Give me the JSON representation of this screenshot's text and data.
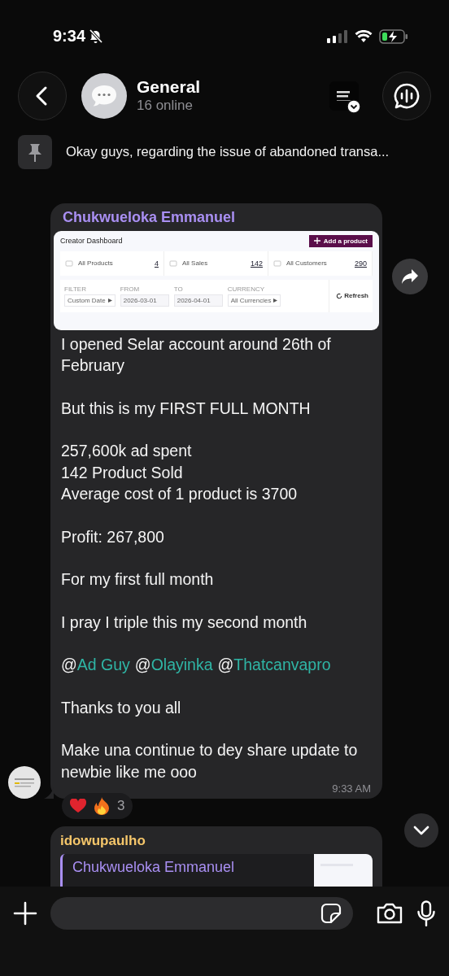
{
  "status_bar": {
    "time": "9:34",
    "silent": true
  },
  "header": {
    "title": "General",
    "subtitle": "16 online"
  },
  "pinned": {
    "text": "Okay guys, regarding the issue of abandoned transa..."
  },
  "message": {
    "sender": "Chukwueloka Emmanuel",
    "time": "9:33 AM",
    "dashboard": {
      "title": "Creator Dashboard",
      "add_button": "Add a product",
      "stats": [
        {
          "label": "All Products",
          "value": "4"
        },
        {
          "label": "All Sales",
          "value": "142"
        },
        {
          "label": "All Customers",
          "value": "290"
        }
      ],
      "filters": [
        {
          "label": "FILTER",
          "value": "Custom Date",
          "kind": "select"
        },
        {
          "label": "FROM",
          "value": "2026-03-01",
          "kind": "date"
        },
        {
          "label": "TO",
          "value": "2026-04-01",
          "kind": "date"
        },
        {
          "label": "CURRENCY",
          "value": "All Currencies",
          "kind": "select"
        }
      ],
      "refresh": "Refresh"
    },
    "paragraphs": [
      {
        "kind": "text",
        "lines": [
          "I opened Selar account around 26th of February"
        ]
      },
      {
        "kind": "text",
        "lines": [
          "But this is my FIRST FULL MONTH"
        ]
      },
      {
        "kind": "text",
        "lines": [
          "257,600k ad spent",
          "142 Product Sold",
          "Average cost of 1 product is 3700"
        ]
      },
      {
        "kind": "text",
        "lines": [
          "Profit: 267,800"
        ]
      },
      {
        "kind": "text",
        "lines": [
          "For my first full month"
        ]
      },
      {
        "kind": "text",
        "lines": [
          "I pray I triple this my second month"
        ]
      },
      {
        "kind": "mentions",
        "mentions": [
          {
            "prefix": "@",
            "name": "Ad Guy"
          },
          {
            "prefix": "@",
            "name": "Olayinka"
          },
          {
            "prefix": "@",
            "name": "Thatcanvapro"
          }
        ]
      },
      {
        "kind": "text",
        "lines": [
          "Thanks to you all"
        ]
      },
      {
        "kind": "text",
        "lines": [
          "Make una continue to dey share update to newbie like me ooo"
        ]
      }
    ],
    "reactions": [
      {
        "kind": "heart"
      },
      {
        "kind": "fire"
      }
    ],
    "reaction_count": "3"
  },
  "next_message": {
    "sender": "idowupaulho",
    "quote_sender": "Chukwueloka Emmanuel"
  }
}
